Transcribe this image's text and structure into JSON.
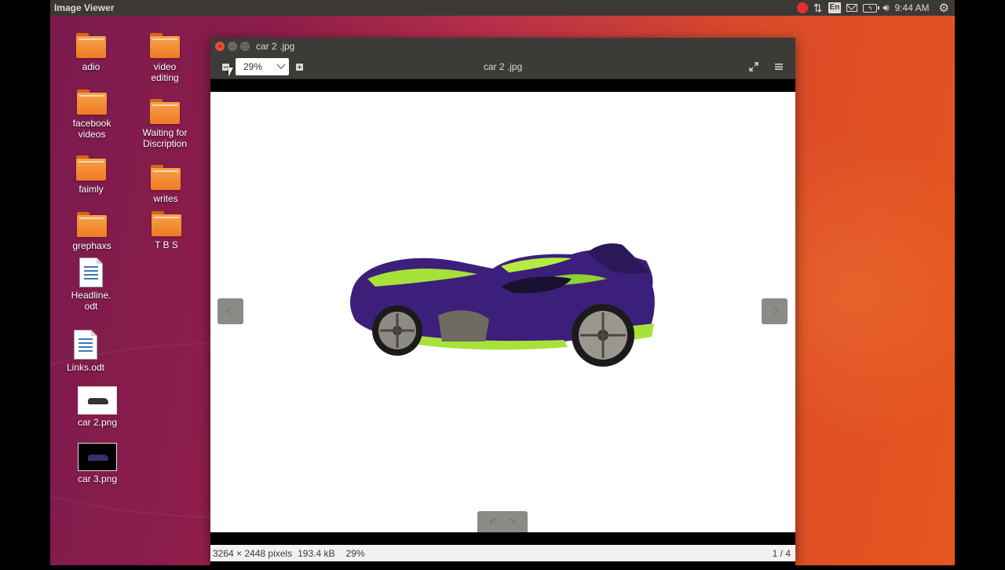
{
  "top_panel": {
    "app_title": "Image Viewer",
    "language": "En",
    "clock": "9:44 AM"
  },
  "desktop": {
    "icons": [
      {
        "label": "adio",
        "type": "folder"
      },
      {
        "label": "video\nediting",
        "type": "folder"
      },
      {
        "label": "facebook\nvideos",
        "type": "folder"
      },
      {
        "label": "Waiting for\nDiscription",
        "type": "folder"
      },
      {
        "label": "faimly",
        "type": "folder"
      },
      {
        "label": "writes",
        "type": "folder"
      },
      {
        "label": "grephaxs",
        "type": "folder"
      },
      {
        "label": "T B S",
        "type": "folder"
      },
      {
        "label": "Headline.\nodt",
        "type": "document"
      },
      {
        "label": "Links.odt",
        "type": "document"
      },
      {
        "label": "car 2.png",
        "type": "image"
      },
      {
        "label": "car 3.png",
        "type": "image"
      }
    ]
  },
  "window": {
    "title": "car 2 .jpg",
    "header_title": "car 2 .jpg",
    "zoom_value": "29%"
  },
  "statusbar": {
    "dimensions": "3264 × 2448 pixels",
    "file_size": "193.4 kB",
    "zoom": "29%",
    "page": "1 / 4"
  },
  "colors": {
    "panel_bg": "#3a3935",
    "window_bg": "#3c3b37",
    "close_button": "#e3503a",
    "folder_orange": "#f39237",
    "car_purple": "#3c1f7a",
    "car_green": "#a7e23a"
  }
}
